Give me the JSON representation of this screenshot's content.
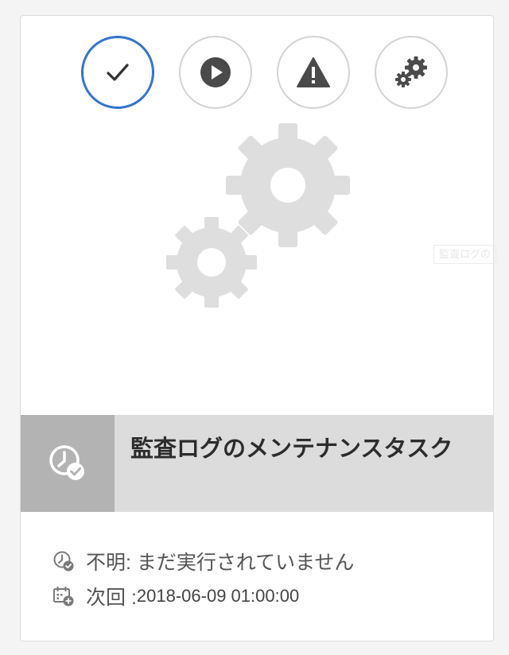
{
  "tooltip": "監査ログの",
  "task": {
    "title": "監査ログのメンテナンスタスク",
    "status_text": "不明: まだ実行されていません",
    "next_label": "次回 : ",
    "next_value": "2018-06-09 01:00:00"
  },
  "quick_actions": [
    {
      "name": "select",
      "icon": "checkmark-icon",
      "selected": true
    },
    {
      "name": "run",
      "icon": "play-icon",
      "selected": false
    },
    {
      "name": "stop",
      "icon": "alert-icon",
      "selected": false
    },
    {
      "name": "configure",
      "icon": "gears-icon",
      "selected": false
    }
  ],
  "colors": {
    "accent": "#2d6fd0",
    "icon_dark": "#4a4a4a",
    "hero_gear": "#dedede",
    "title_bar": "#dcdcdc",
    "type_box": "#b3b3b3"
  }
}
